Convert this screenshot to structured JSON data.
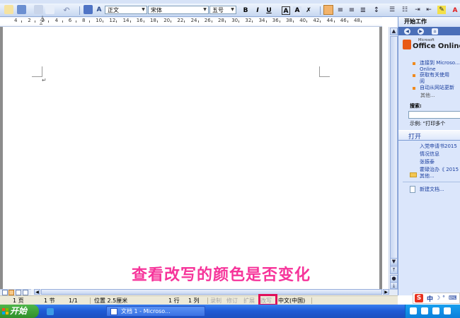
{
  "toolbar": {
    "style_value": "正文",
    "font_value": "宋体",
    "size_value": "五号",
    "bold": "B",
    "italic": "I",
    "underline": "U",
    "char_border": "A",
    "font_color": "A",
    "font_color_hex": "#e02020",
    "highlight_hex": "#f3e04a",
    "undo": "↶"
  },
  "ruler": {
    "numbers": [
      "4",
      "2",
      "2",
      "4",
      "6",
      "8",
      "10",
      "12",
      "14",
      "16",
      "18",
      "20",
      "22",
      "24",
      "26",
      "28",
      "30",
      "32",
      "34",
      "36",
      "38",
      "40",
      "42",
      "44",
      "46",
      "48"
    ]
  },
  "document": {
    "paragraph_mark": "↵"
  },
  "taskpane": {
    "title": "开始工作",
    "logo_text": "Office Online",
    "logo_small": "Microsoft",
    "links": [
      "连接到 Microso...",
      "Online",
      "获取有关使用",
      "阅",
      "自动从网站更新"
    ],
    "more": "其他...",
    "search_label": "搜索:",
    "example": "示例: “打印多个",
    "open_header": "打开",
    "open_items": [
      "入党申请书2015",
      "情况信息",
      "张振泰",
      "霍碌治办《 2015"
    ],
    "open_more": "其他...",
    "new_doc": "新建文档..."
  },
  "statusbar": {
    "page": "1 页",
    "section": "1 节",
    "page_of": "1/1",
    "position": "位置 2.5厘米",
    "line": "1 行",
    "column": "1 列",
    "rec": "录制",
    "trk": "修订",
    "ext": "扩展",
    "ovr": "改写",
    "lang": "中文(中国)"
  },
  "caption": "查看改写的颜色是否变化",
  "taskbar": {
    "start": "开始",
    "task_word": "文档 1 - Microso...",
    "ime_letter": "S",
    "ime_mode": "中"
  },
  "colors": {
    "caption": "#f6349a",
    "highlight_box": "#e0105a",
    "taskbar": "#2461d8",
    "start": "#3a9f35"
  }
}
